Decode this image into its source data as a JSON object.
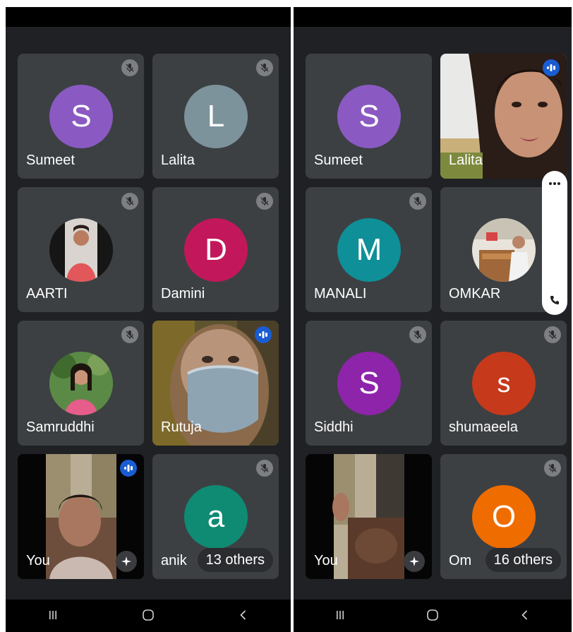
{
  "theme": {
    "background": "#202124",
    "tile_bg": "#3c4043",
    "speaking_badge": "#1a5cd2",
    "muted_badge": "#7d7f82"
  },
  "left": {
    "tiles": [
      {
        "name": "Sumeet",
        "initial": "S",
        "color": "#8a5ac2",
        "status": "muted"
      },
      {
        "name": "Lalita",
        "initial": "L",
        "color": "#7d939b",
        "status": "muted"
      },
      {
        "name": "AARTI",
        "status": "muted",
        "avatar": "photo"
      },
      {
        "name": "Damini",
        "initial": "D",
        "color": "#c2185b",
        "status": "muted"
      },
      {
        "name": "Samruddhi",
        "status": "muted",
        "avatar": "photo"
      },
      {
        "name": "Rutuja",
        "status": "speaking",
        "video": "camera"
      },
      {
        "name": "You",
        "status": "speaking",
        "video": "camera",
        "effects_icon": "sparkle-icon"
      },
      {
        "name": "anik",
        "initial": "a",
        "color": "#0f8a73",
        "status": "muted",
        "others_label": "13 others"
      }
    ]
  },
  "right": {
    "tiles": [
      {
        "name": "Sumeet",
        "initial": "S",
        "color": "#8a5ac2",
        "status": "none"
      },
      {
        "name": "Lalita",
        "status": "speaking",
        "video": "camera"
      },
      {
        "name": "MANALI",
        "initial": "M",
        "color": "#0f8f98",
        "status": "muted"
      },
      {
        "name": "OMKAR",
        "status": "none",
        "avatar": "photo"
      },
      {
        "name": "Siddhi",
        "initial": "S",
        "color": "#8e24aa",
        "status": "muted"
      },
      {
        "name": "shumaeela",
        "initial": "s",
        "color": "#c6391a",
        "status": "muted"
      },
      {
        "name": "You",
        "status": "none",
        "video": "camera",
        "effects_icon": "sparkle-icon"
      },
      {
        "name": "Om",
        "initial": "O",
        "color": "#ef6c00",
        "status": "muted",
        "others_label": "16 others"
      }
    ],
    "floating_controls": {
      "more_icon": "more-dots-icon",
      "call_icon": "phone-icon"
    }
  },
  "nav": {
    "recent_icon": "recent-apps-icon",
    "home_icon": "home-icon",
    "back_icon": "back-icon"
  }
}
